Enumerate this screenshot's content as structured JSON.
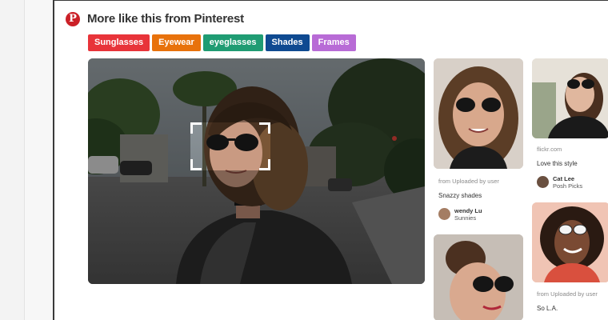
{
  "header": {
    "logo_glyph": "P",
    "title": "More like this from Pinterest"
  },
  "tags": [
    {
      "label": "Sunglasses",
      "color": "#e8343a"
    },
    {
      "label": "Eyewear",
      "color": "#e8720c"
    },
    {
      "label": "eyeglasses",
      "color": "#1f9c73"
    },
    {
      "label": "Shades",
      "color": "#0f4a91"
    },
    {
      "label": "Frames",
      "color": "#b86bd6"
    }
  ],
  "cards": [
    {
      "source": "from Uploaded by user",
      "description": "Snazzy shades",
      "user": "wendy Lu",
      "board": "Sunnies"
    },
    {
      "source": "flickr.com",
      "description": "Love this style",
      "user": "Cat Lee",
      "board": "Posh Picks"
    },
    {
      "source": "from Uploaded by user",
      "description": "So L.A."
    }
  ]
}
